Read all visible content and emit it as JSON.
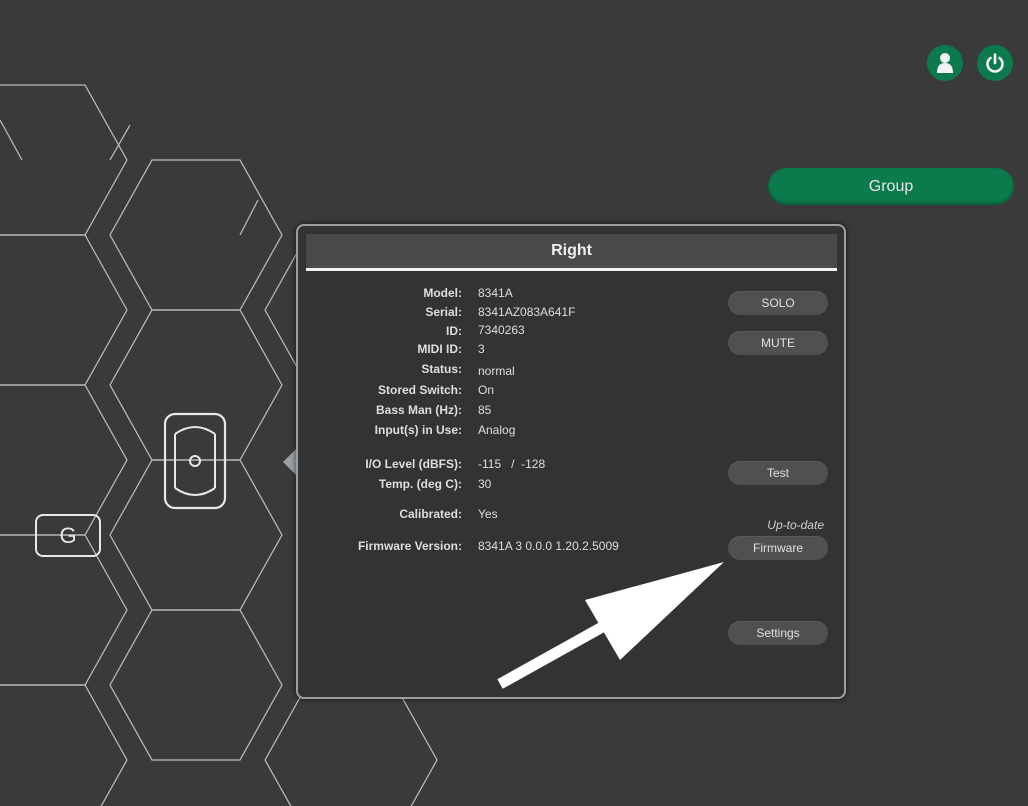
{
  "header": {
    "user_icon": "user-icon",
    "power_icon": "power-icon"
  },
  "group_button": {
    "label": "Group"
  },
  "speakers": {
    "group_tile_label": "G",
    "selected_speaker_icon": "speaker-icon"
  },
  "panel": {
    "title": "Right",
    "info": [
      {
        "label": "Model:",
        "value": "8341A"
      },
      {
        "label": "Serial:",
        "value": "8341AZ083A641F"
      },
      {
        "label": "ID:",
        "value": "7340263"
      },
      {
        "label": "MIDI ID:",
        "value": "3"
      },
      {
        "label": "Status:",
        "value": "normal"
      },
      {
        "label": "Stored Switch:",
        "value": "On"
      },
      {
        "label": "Bass Man (Hz):",
        "value": "85"
      },
      {
        "label": "Input(s) in Use:",
        "value": "Analog"
      },
      {
        "label": "I/O Level (dBFS):",
        "value": "-115   /  -128"
      },
      {
        "label": "Temp. (deg C):",
        "value": "30"
      },
      {
        "label": "Calibrated:",
        "value": "Yes"
      },
      {
        "label": "Firmware Version:",
        "value": "8341A 3 0.0.0 1.20.2.5009"
      }
    ],
    "buttons": {
      "solo": "SOLO",
      "mute": "MUTE",
      "test": "Test",
      "firmware": "Firmware",
      "settings": "Settings"
    },
    "firmware_status": "Up-to-date"
  },
  "colors": {
    "background": "#3a3a3a",
    "accent_green": "#0b7a4c",
    "panel_bg": "#333333",
    "panel_border": "#9aa0a3",
    "pill_bg": "#505050"
  }
}
